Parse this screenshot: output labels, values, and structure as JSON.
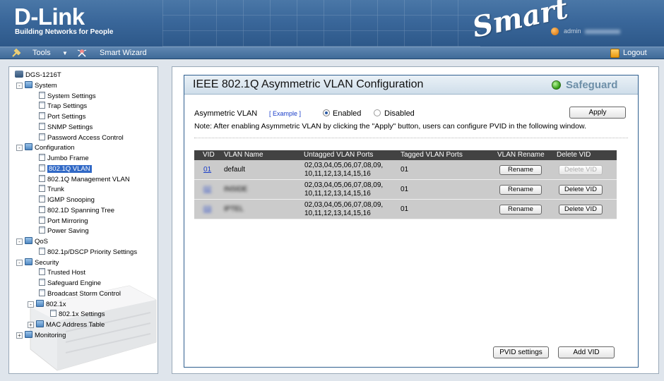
{
  "banner": {
    "brand": "D-Link",
    "tagline": "Building Networks for People",
    "product_mark": "Smart",
    "user": "admin"
  },
  "toolbar": {
    "tools_label": "Tools",
    "wizard_label": "Smart Wizard",
    "logout_label": "Logout"
  },
  "tree": {
    "items": [
      {
        "label": "DGS-1216T",
        "icon": "device-icon"
      },
      {
        "label": "System",
        "icon": "folder-icon",
        "expander": "-"
      },
      {
        "label": "System Settings",
        "icon": "page-icon"
      },
      {
        "label": "Trap Settings",
        "icon": "page-icon"
      },
      {
        "label": "Port Settings",
        "icon": "page-icon"
      },
      {
        "label": "SNMP Settings",
        "icon": "page-icon"
      },
      {
        "label": "Password Access Control",
        "icon": "page-icon"
      },
      {
        "label": "Configuration",
        "icon": "folder-icon",
        "expander": "-"
      },
      {
        "label": "Jumbo Frame",
        "icon": "page-icon"
      },
      {
        "label": "802.1Q VLAN",
        "icon": "page-icon",
        "selected": true
      },
      {
        "label": "802.1Q Management VLAN",
        "icon": "page-icon"
      },
      {
        "label": "Trunk",
        "icon": "page-icon"
      },
      {
        "label": "IGMP Snooping",
        "icon": "page-icon"
      },
      {
        "label": "802.1D Spanning Tree",
        "icon": "page-icon"
      },
      {
        "label": "Port Mirroring",
        "icon": "page-icon"
      },
      {
        "label": "Power Saving",
        "icon": "page-icon"
      },
      {
        "label": "QoS",
        "icon": "folder-icon",
        "expander": "-"
      },
      {
        "label": "802.1p/DSCP Priority Settings",
        "icon": "page-icon"
      },
      {
        "label": "Security",
        "icon": "folder-icon",
        "expander": "-"
      },
      {
        "label": "Trusted Host",
        "icon": "page-icon"
      },
      {
        "label": "Safeguard Engine",
        "icon": "page-icon"
      },
      {
        "label": "Broadcast Storm Control",
        "icon": "page-icon"
      },
      {
        "label": "802.1x",
        "icon": "folder-icon",
        "expander": "-"
      },
      {
        "label": "802.1x Settings",
        "icon": "page-icon"
      },
      {
        "label": "MAC Address Table",
        "icon": "folder-icon",
        "expander": "+"
      },
      {
        "label": "Monitoring",
        "icon": "folder-icon",
        "expander": "+"
      }
    ]
  },
  "main": {
    "title": "IEEE 802.1Q Asymmetric VLAN Configuration",
    "safeguard": "Safeguard",
    "asym_label": "Asymmetric VLAN",
    "example_link": "[ Example ]",
    "enabled_label": "Enabled",
    "disabled_label": "Disabled",
    "selected_mode": "Enabled",
    "apply_label": "Apply",
    "note": "Note: After enabling Asymmetric VLAN by clicking the \"Apply\" button, users can configure PVID in the following window.",
    "table": {
      "headers": [
        "VID",
        "VLAN Name",
        "Untagged VLAN Ports",
        "Tagged VLAN Ports",
        "VLAN Rename",
        "Delete VID"
      ],
      "rows": [
        {
          "vid": "01",
          "name": "default",
          "untagged_line1": "02,03,04,05,06,07,08,09,",
          "untagged_line2": "10,11,12,13,14,15,16",
          "tagged": "01",
          "rename": "Rename",
          "delete": "Delete VID",
          "delete_enabled": false
        },
        {
          "vid": "02",
          "name": "INSIDE",
          "untagged_line1": "02,03,04,05,06,07,08,09,",
          "untagged_line2": "10,11,12,13,14,15,16",
          "tagged": "01",
          "rename": "Rename",
          "delete": "Delete VID",
          "delete_enabled": true
        },
        {
          "vid": "03",
          "name": "IPTEL",
          "untagged_line1": "02,03,04,05,06,07,08,09,",
          "untagged_line2": "10,11,12,13,14,15,16",
          "tagged": "01",
          "rename": "Rename",
          "delete": "Delete VID",
          "delete_enabled": true
        }
      ]
    },
    "pvid_label": "PVID settings",
    "addvid_label": "Add VID"
  },
  "colors": {
    "banner": "#3a679a",
    "table_header": "#424242",
    "table_row": "#cbcbcb",
    "link": "#1a3ec9",
    "selected_tree": "#3169c6",
    "safeguard_led": "#2f9a12"
  }
}
